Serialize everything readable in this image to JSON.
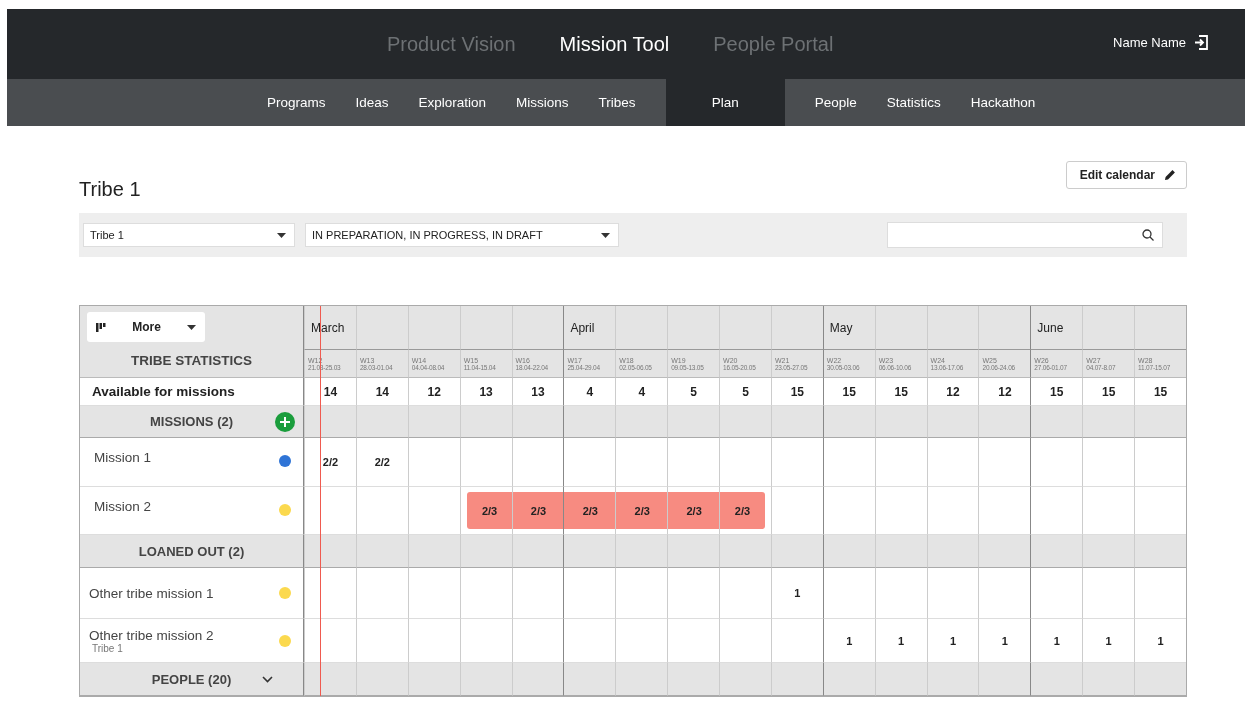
{
  "apps": [
    {
      "label": "Product Vision",
      "selected": false
    },
    {
      "label": "Mission Tool",
      "selected": true
    },
    {
      "label": "People Portal",
      "selected": false
    }
  ],
  "user": {
    "name": "Name Name"
  },
  "tabs": [
    {
      "label": "Programs",
      "selected": false
    },
    {
      "label": "Ideas",
      "selected": false
    },
    {
      "label": "Exploration",
      "selected": false
    },
    {
      "label": "Missions",
      "selected": false
    },
    {
      "label": "Tribes",
      "selected": false
    },
    {
      "label": "Plan",
      "selected": true
    },
    {
      "label": "People",
      "selected": false
    },
    {
      "label": "Statistics",
      "selected": false
    },
    {
      "label": "Hackathon",
      "selected": false
    }
  ],
  "page_title": "Tribe 1",
  "edit_button": "Edit calendar",
  "filters": {
    "tribe": "Tribe 1",
    "status": "IN PREPARATION, IN PROGRESS, IN DRAFT"
  },
  "planner": {
    "more_button": "More",
    "stats_title": "TRIBE STATISTICS",
    "available_label": "Available for missions",
    "weeks": [
      {
        "month": "March",
        "week": "W12",
        "dates": "21.03-25.03",
        "available": "14"
      },
      {
        "week": "W13",
        "dates": "28.03-01.04",
        "available": "14"
      },
      {
        "week": "W14",
        "dates": "04.04-08.04",
        "available": "12"
      },
      {
        "week": "W15",
        "dates": "11.04-15.04",
        "available": "13"
      },
      {
        "week": "W16",
        "dates": "18.04-22.04",
        "available": "13"
      },
      {
        "month": "April",
        "week": "W17",
        "dates": "25.04-29.04",
        "available": "4"
      },
      {
        "week": "W18",
        "dates": "02.05-06.05",
        "available": "4"
      },
      {
        "week": "W19",
        "dates": "09.05-13.05",
        "available": "5"
      },
      {
        "week": "W20",
        "dates": "16.05-20.05",
        "available": "5"
      },
      {
        "week": "W21",
        "dates": "23.05-27.05",
        "available": "15"
      },
      {
        "month": "May",
        "week": "W22",
        "dates": "30.05-03.06",
        "available": "15"
      },
      {
        "week": "W23",
        "dates": "06.06-10.06",
        "available": "15"
      },
      {
        "week": "W24",
        "dates": "13.06-17.06",
        "available": "12"
      },
      {
        "week": "W25",
        "dates": "20.06-24.06",
        "available": "12"
      },
      {
        "month": "June",
        "week": "W26",
        "dates": "27.06-01.07",
        "available": "15"
      },
      {
        "week": "W27",
        "dates": "04.07-8.07",
        "available": "15"
      },
      {
        "week": "W28",
        "dates": "11.07-15.07",
        "available": "15"
      }
    ],
    "sections": [
      {
        "kind": "missions",
        "title": "MISSIONS (2)",
        "items": [
          {
            "name": "Mission 1",
            "color": "#2f74d6",
            "cells": [
              {
                "value": "2/2",
                "alert": false
              },
              {
                "value": "2/2",
                "alert": false
              },
              null,
              null,
              null,
              null,
              null,
              null,
              null,
              null,
              null,
              null,
              null,
              null,
              null,
              null,
              null
            ]
          },
          {
            "name": "Mission 2",
            "color": "#fbd94e",
            "cells": [
              null,
              null,
              null,
              {
                "value": "2/3",
                "alert": true
              },
              {
                "value": "2/3",
                "alert": true
              },
              {
                "value": "2/3",
                "alert": true
              },
              {
                "value": "2/3",
                "alert": true
              },
              {
                "value": "2/3",
                "alert": true
              },
              {
                "value": "2/3",
                "alert": true
              },
              null,
              null,
              null,
              null,
              null,
              null,
              null,
              null
            ]
          }
        ]
      },
      {
        "kind": "loaned",
        "title": "LOANED OUT (2)",
        "items": [
          {
            "name": "Other tribe mission 1",
            "color": "#fbd94e",
            "cells": [
              null,
              null,
              null,
              null,
              null,
              null,
              null,
              null,
              null,
              {
                "value": "1",
                "alert": false
              },
              null,
              null,
              null,
              null,
              null,
              null,
              null
            ]
          },
          {
            "name": "Other tribe mission 2",
            "subtitle": "Tribe 1",
            "color": "#fbd94e",
            "cells": [
              null,
              null,
              null,
              null,
              null,
              null,
              null,
              null,
              null,
              null,
              {
                "value": "1",
                "alert": false
              },
              {
                "value": "1",
                "alert": false
              },
              {
                "value": "1",
                "alert": false
              },
              {
                "value": "1",
                "alert": false
              },
              {
                "value": "1",
                "alert": false
              },
              {
                "value": "1",
                "alert": false
              },
              {
                "value": "1",
                "alert": false
              }
            ]
          }
        ]
      },
      {
        "kind": "people",
        "title": "PEOPLE (20)",
        "expanded": false
      }
    ]
  }
}
